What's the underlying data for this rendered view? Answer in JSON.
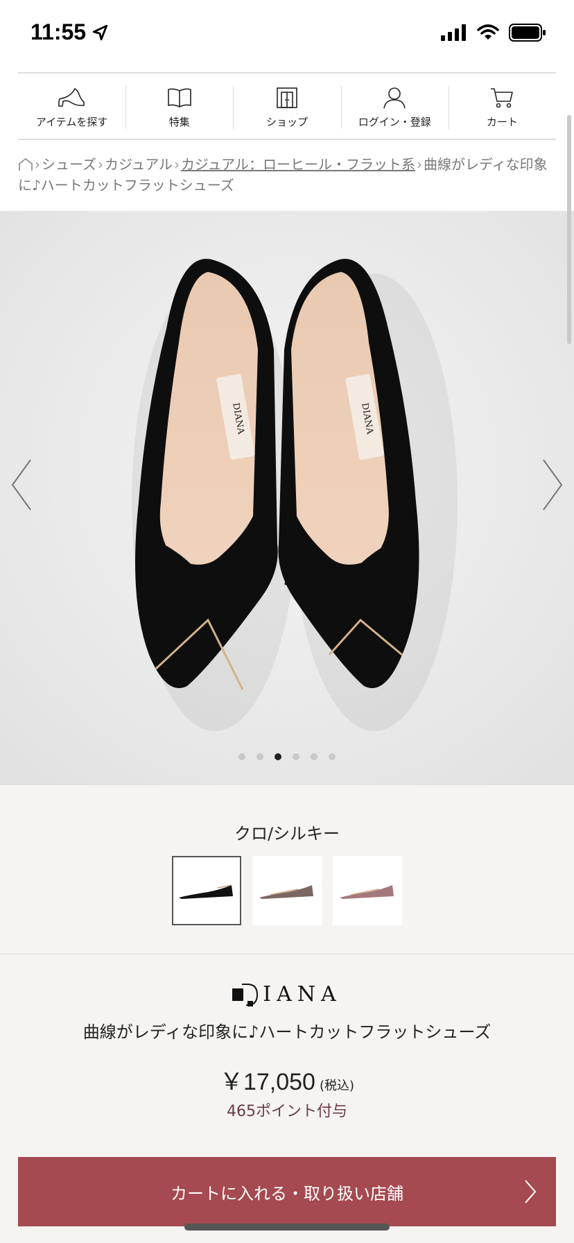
{
  "status": {
    "time": "11:55"
  },
  "nav": {
    "items": [
      {
        "label": "アイテムを探す",
        "icon": "heel-icon"
      },
      {
        "label": "特集",
        "icon": "book-icon"
      },
      {
        "label": "ショップ",
        "icon": "shop-door-icon"
      },
      {
        "label": "ログイン・登録",
        "icon": "user-icon"
      },
      {
        "label": "カート",
        "icon": "cart-icon"
      }
    ]
  },
  "breadcrumb": {
    "items": [
      "シューズ",
      "カジュアル",
      "カジュアル：ローヒール・フラット系",
      "曲線がレディな印象に♪ハートカットフラットシューズ"
    ]
  },
  "gallery": {
    "image": "black-suede-flat-shoes",
    "insole_brand": "DIANA",
    "dots_total": 6,
    "active_index": 2
  },
  "variant": {
    "color_name": "クロ/シルキー",
    "thumbs": [
      {
        "color": "#111111",
        "selected": true
      },
      {
        "color": "#7b6662",
        "selected": false
      },
      {
        "color": "#a5787d",
        "selected": false
      }
    ]
  },
  "product": {
    "brand": "IANA",
    "name": "曲線がレディな印象に♪ハートカットフラットシューズ",
    "price": "￥17,050",
    "tax_note": "(税込)",
    "points": "465ポイント付与"
  },
  "cart_button": {
    "label": "カートに入れる・取り扱い店舗"
  },
  "colors": {
    "accent": "#a54a50",
    "points": "#6b3a4a"
  }
}
